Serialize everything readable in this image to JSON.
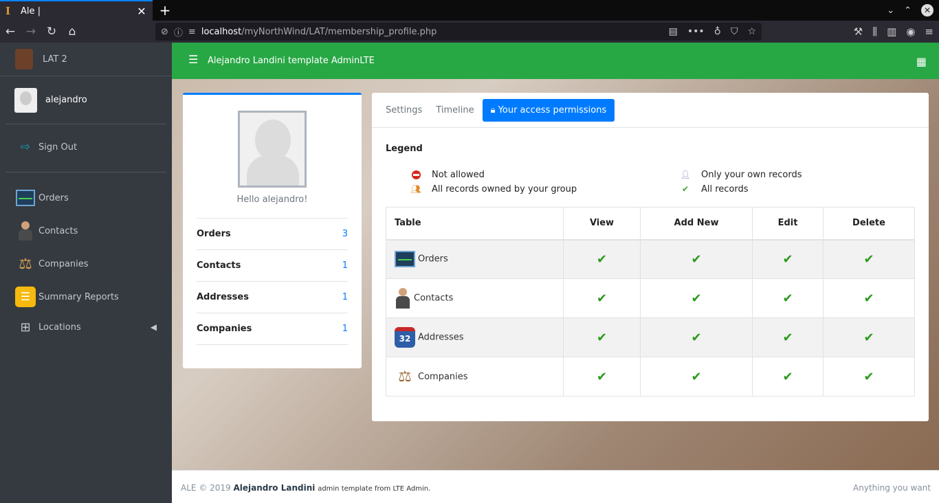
{
  "browser": {
    "tab_title": "Ale |",
    "url_host": "localhost",
    "url_path": "/myNorthWind/LAT/membership_profile.php"
  },
  "sidebar": {
    "brand": "LAT 2",
    "user": "alejandro",
    "sign_out": "Sign Out",
    "items": [
      {
        "label": "Orders",
        "icon": "orders-icon"
      },
      {
        "label": "Contacts",
        "icon": "contacts-icon"
      },
      {
        "label": "Companies",
        "icon": "scale-icon"
      },
      {
        "label": "Summary Reports",
        "icon": "report-icon"
      },
      {
        "label": "Locations",
        "icon": "grid-icon"
      }
    ]
  },
  "topbar": {
    "title": "Alejandro Landini template AdminLTE"
  },
  "profile": {
    "greeting": "Hello alejandro!",
    "stats": [
      {
        "label": "Orders",
        "value": "3"
      },
      {
        "label": "Contacts",
        "value": "1"
      },
      {
        "label": "Addresses",
        "value": "1"
      },
      {
        "label": "Companies",
        "value": "1"
      }
    ]
  },
  "perm": {
    "tabs": [
      "Settings",
      "Timeline",
      "Your access permissions"
    ],
    "legend_title": "Legend",
    "legend": {
      "not_allowed": "Not allowed",
      "group": "All records owned by your group",
      "own": "Only your own records",
      "all": "All records"
    },
    "columns": [
      "Table",
      "View",
      "Add New",
      "Edit",
      "Delete"
    ],
    "rows": [
      {
        "table": "Orders",
        "icon": "orders-icon"
      },
      {
        "table": "Contacts",
        "icon": "contacts-icon"
      },
      {
        "table": "Addresses",
        "icon": "highway-shield-icon",
        "icon_text": "32"
      },
      {
        "table": "Companies",
        "icon": "scale-icon"
      }
    ],
    "cell_value": "all-records"
  },
  "footer": {
    "prefix": "ALE © 2019",
    "author": "Alejandro Landini",
    "suffix": "admin template from LTE Admin.",
    "right": "Anything you want"
  },
  "colors": {
    "topbar": "#28a745",
    "accent": "#007bff",
    "sidebar": "#343a40"
  }
}
